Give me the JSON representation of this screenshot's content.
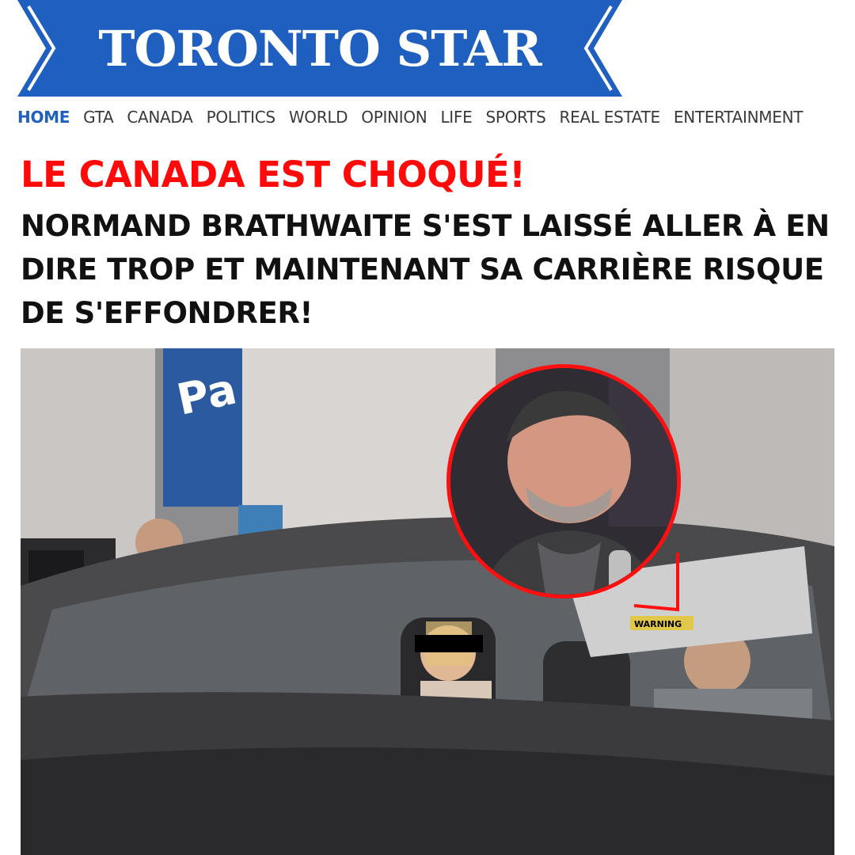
{
  "brand": {
    "name": "TORONTO STAR",
    "color": "#1f5fbf"
  },
  "nav": {
    "items": [
      {
        "label": "HOME",
        "active": true
      },
      {
        "label": "GTA"
      },
      {
        "label": "CANADA"
      },
      {
        "label": "POLITICS"
      },
      {
        "label": "WORLD"
      },
      {
        "label": "OPINION"
      },
      {
        "label": "LIFE"
      },
      {
        "label": "SPORTS"
      },
      {
        "label": "REAL ESTATE"
      },
      {
        "label": "ENTERTAINMENT"
      }
    ],
    "active_color": "#1f5fbf"
  },
  "article": {
    "kicker": "LE CANADA EST CHOQUÉ!",
    "kicker_color": "#ff0a0a",
    "headline": "NORMAND BRATHWAITE S'EST LAISSÉ ALLER À EN DIRE TROP ET MAINTENANT SA CARRIÈRE RISQUE DE S'EFFONDRER!",
    "photo": {
      "sign_text": "Pa",
      "visor_label": "WARNING",
      "inset_border_color": "#ff1010"
    }
  }
}
